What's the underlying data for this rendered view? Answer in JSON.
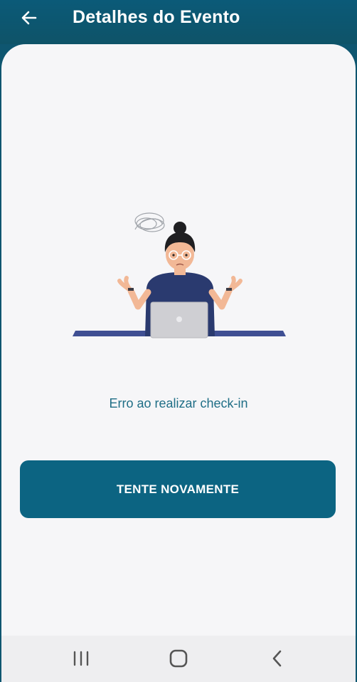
{
  "app_bar": {
    "title": "Detalhes do Evento",
    "back_icon": "arrow-left-icon"
  },
  "main": {
    "illustration": "confused-woman-with-laptop",
    "error_message": "Erro ao realizar check-in",
    "retry_label": "TENTE NOVAMENTE"
  },
  "nav_bar": {
    "recents_icon": "recent-apps-icon",
    "home_icon": "home-icon",
    "back_icon": "back-chevron-icon"
  },
  "colors": {
    "app_bar": "#0e5670",
    "background": "#f6f6f8",
    "accent": "#0c6482",
    "message_text": "#1f6e86"
  }
}
